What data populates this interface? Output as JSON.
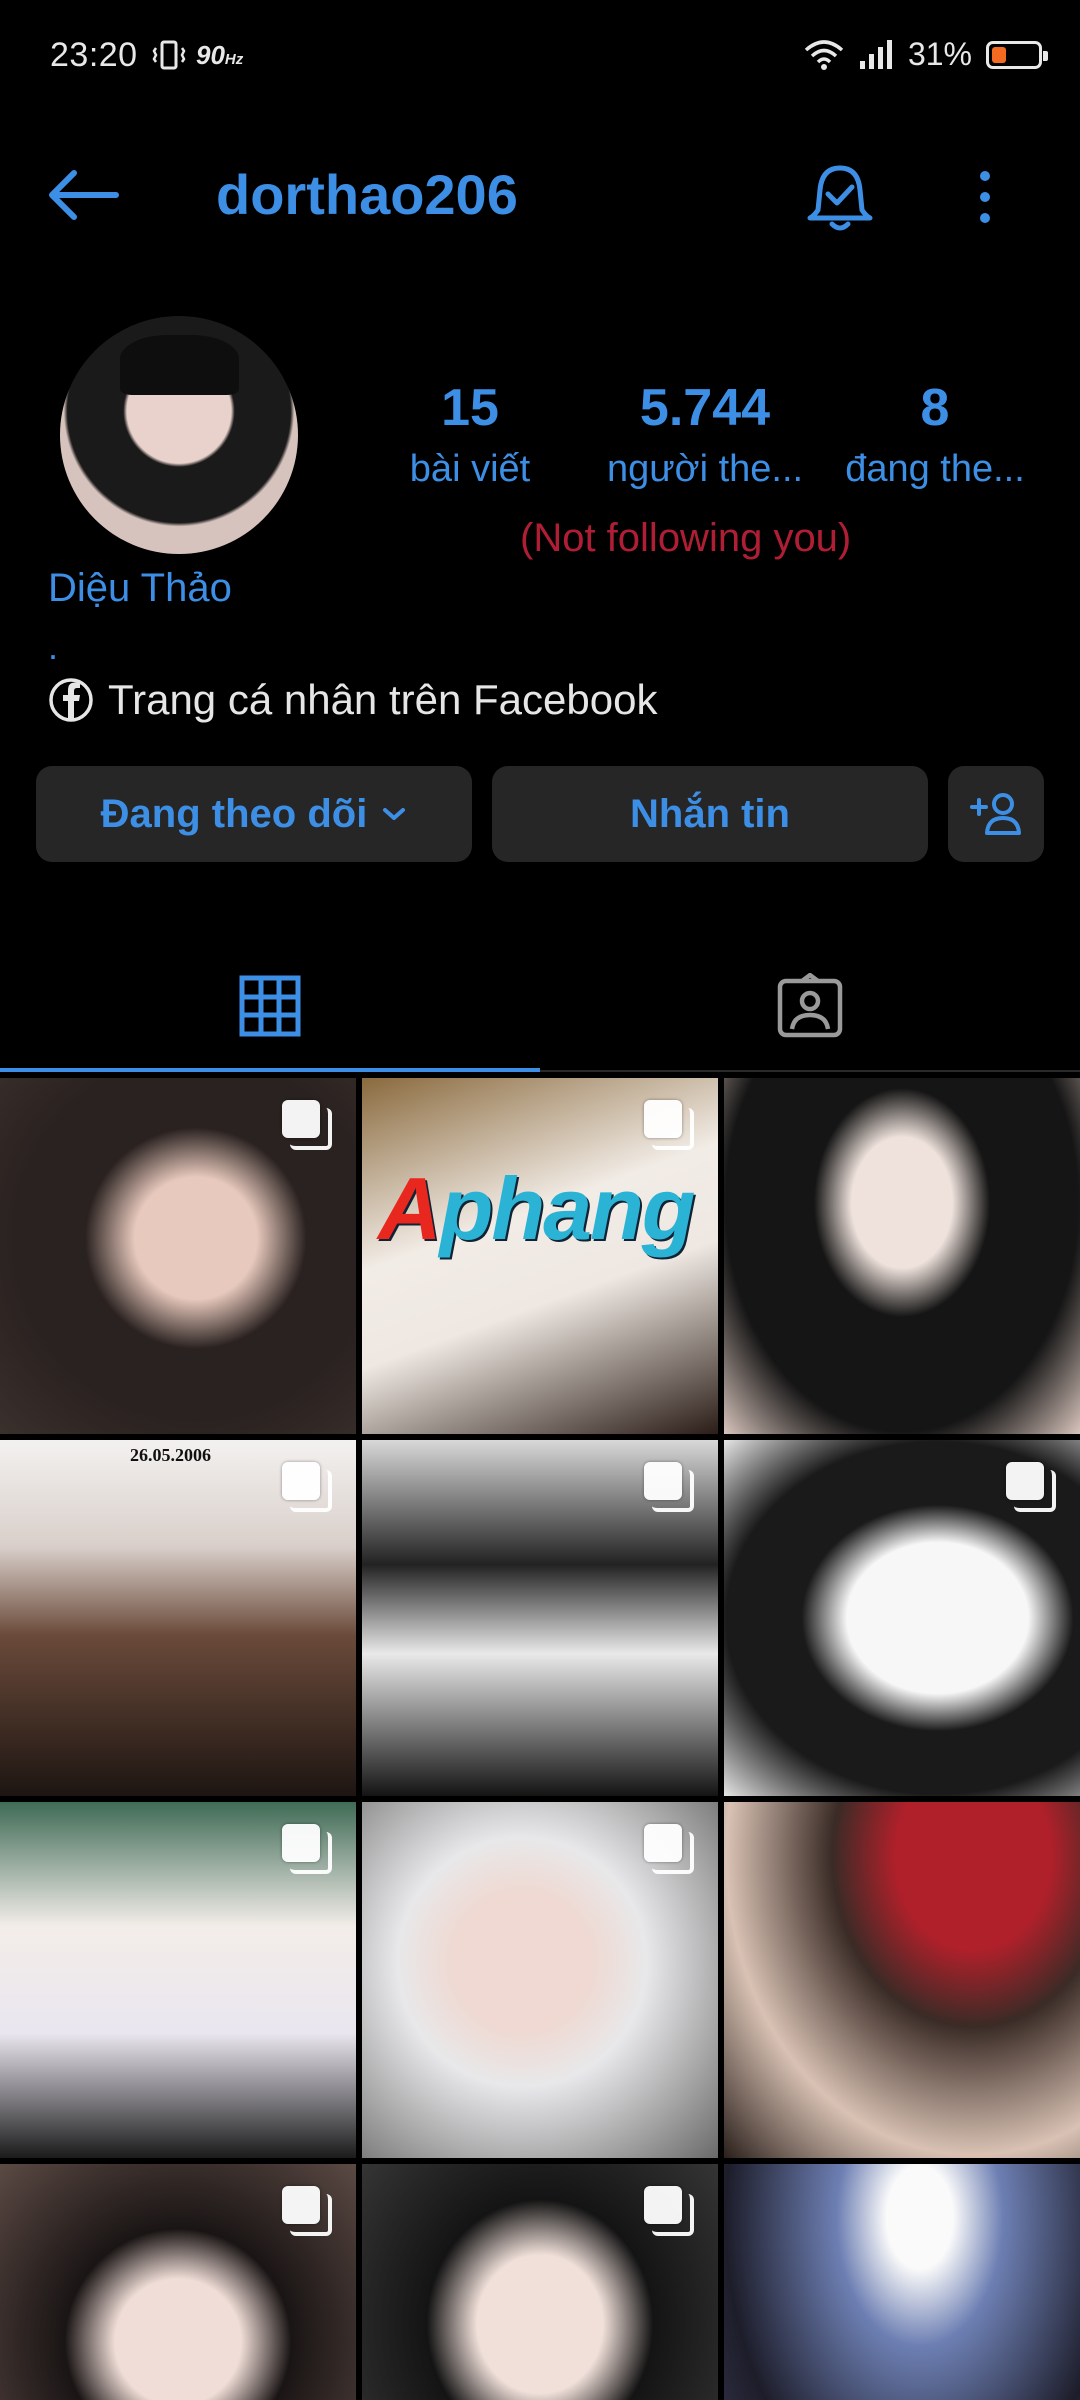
{
  "status_bar": {
    "time": "23:20",
    "refresh_rate": "90",
    "refresh_unit": "Hz",
    "battery": "31%",
    "battery_level": 0.31,
    "battery_color": "#f36b21"
  },
  "header": {
    "username": "dorthao206",
    "back_icon": "arrow-left-icon",
    "bell_icon": "notification-bell-check-icon",
    "more_icon": "more-vertical-icon"
  },
  "profile": {
    "display_name": "Diệu Thảo",
    "bio": ".",
    "facebook_link": "Trang cá nhân trên Facebook",
    "not_following": "(Not following you)"
  },
  "stats": [
    {
      "value": "15",
      "label": "bài viết"
    },
    {
      "value": "5.744",
      "label": "người the..."
    },
    {
      "value": "8",
      "label": "đang the..."
    }
  ],
  "actions": {
    "following": "Đang theo dõi",
    "message": "Nhắn tin"
  },
  "tabs": [
    {
      "name": "posts-grid",
      "icon": "grid-icon",
      "active": true
    },
    {
      "name": "tagged",
      "icon": "tagged-person-icon",
      "active": false
    }
  ],
  "watermark": {
    "part_red": "A",
    "part_blue": "phang"
  },
  "date_stamp": "26.05.2006",
  "colors": {
    "accent": "#3d8fe6",
    "alert": "#b01e35",
    "button_bg": "#262626"
  }
}
